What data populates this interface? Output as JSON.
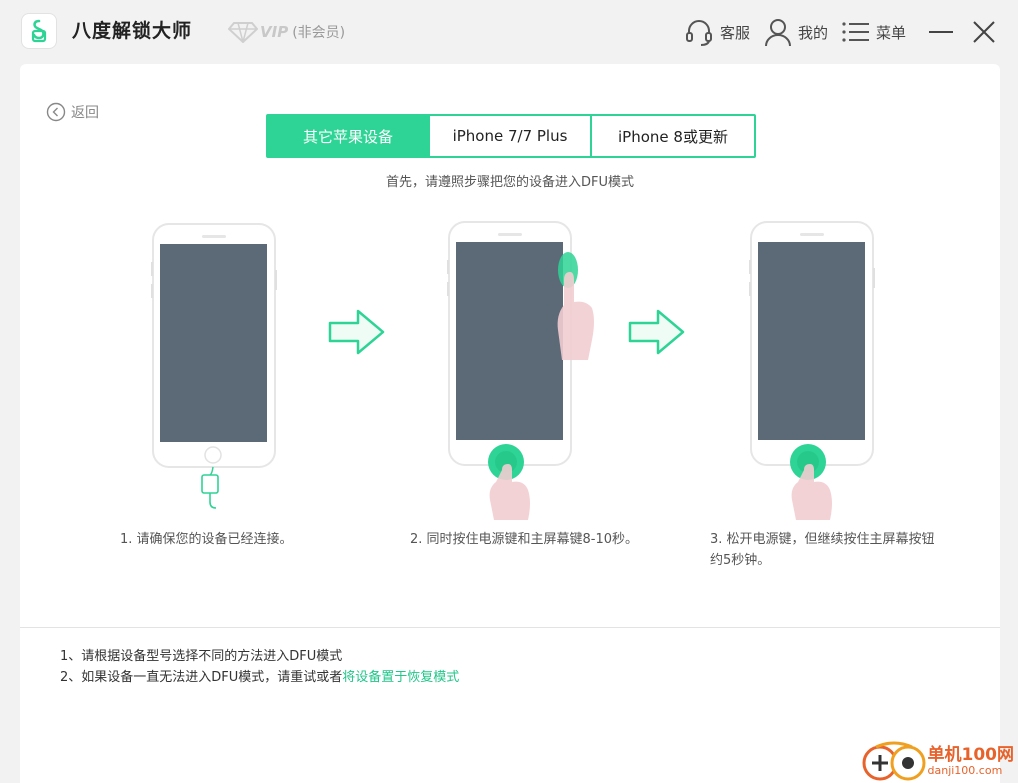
{
  "app": {
    "title": "八度解锁大师",
    "vip_label": "VIP",
    "member_status": "(非会员)"
  },
  "header": {
    "service": "客服",
    "mine": "我的",
    "menu": "菜单"
  },
  "back": {
    "label": "返回"
  },
  "tabs": [
    {
      "label": "其它苹果设备",
      "active": true
    },
    {
      "label": "iPhone 7/7 Plus",
      "active": false
    },
    {
      "label": "iPhone 8或更新",
      "active": false
    }
  ],
  "subtitle": "首先，请遵照步骤把您的设备进入DFU模式",
  "steps": [
    {
      "caption": "1. 请确保您的设备已经连接。"
    },
    {
      "caption": "2. 同时按住电源键和主屏幕键8-10秒。"
    },
    {
      "caption_line1": "3. 松开电源键，但继续按住主屏幕按钮",
      "caption_line2": "约5秒钟。"
    }
  ],
  "notes": {
    "line1": "1、请根据设备型号选择不同的方法进入DFU模式",
    "line2_prefix": "2、如果设备一直无法进入DFU模式，请重试或者",
    "line2_link": "将设备置于恢复模式"
  },
  "watermark": {
    "cn": "单机100网",
    "en": "danji100.com"
  },
  "colors": {
    "accent": "#2ed495",
    "link": "#22c58a",
    "phone_screen": "#5c6a78"
  }
}
